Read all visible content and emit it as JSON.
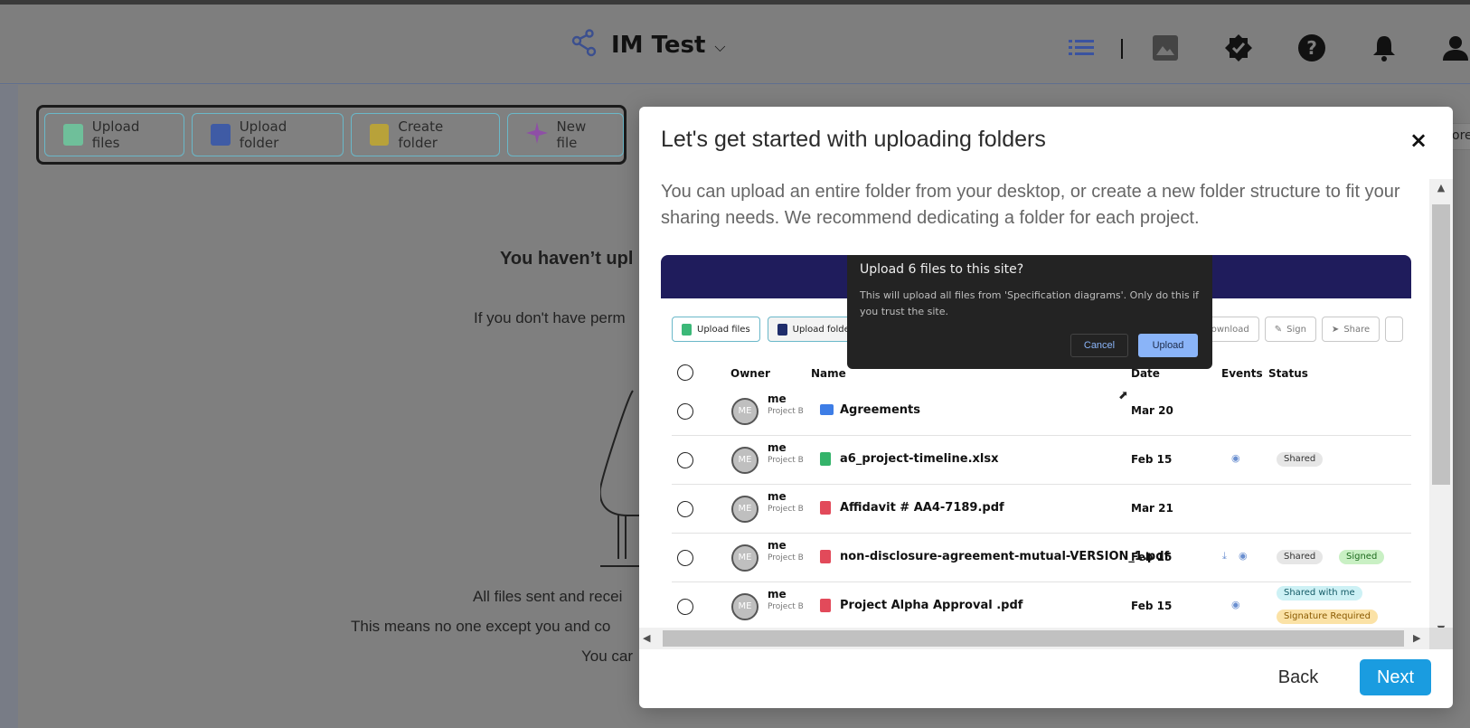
{
  "header": {
    "title": "IM Test",
    "icons": [
      "workflow-icon",
      "chevron-down-icon",
      "list-view-icon",
      "gallery-icon",
      "verified-badge-icon",
      "help-icon",
      "bell-icon",
      "user-icon"
    ]
  },
  "toolbar": {
    "upload_files": "Upload files",
    "upload_folder": "Upload folder",
    "create_folder": "Create folder",
    "new_file": "New file"
  },
  "empty": {
    "title": "You haven’t upl",
    "subtitle": "If you don't have perm",
    "line1": "All files sent and recei",
    "line2": "This means no one except you and co",
    "line3": "You car"
  },
  "right_peek": "ore",
  "modal": {
    "title": "Let's get started with uploading folders",
    "description": "You can upload an entire folder from your desktop, or create a new folder structure to fit your sharing needs. We recommend dedicating a folder for each project.",
    "back": "Back",
    "next": "Next",
    "close": "×"
  },
  "screenshot": {
    "dialog": {
      "title": "Upload 6 files to this site?",
      "body": "This will upload all files from 'Specification diagrams'. Only do this if you trust the site.",
      "cancel": "Cancel",
      "upload": "Upload"
    },
    "toolbar_left": [
      "Upload files",
      "Upload folder"
    ],
    "toolbar_right": [
      "Download",
      "Sign",
      "Share"
    ],
    "columns": {
      "owner": "Owner",
      "name": "Name",
      "date": "Date",
      "events": "Events",
      "status": "Status"
    },
    "rows": [
      {
        "avatar": "ME",
        "owner": "me",
        "project": "Project B",
        "name": "Agreements",
        "type": "folder",
        "date": "Mar 20",
        "events": [],
        "status": []
      },
      {
        "avatar": "ME",
        "owner": "me",
        "project": "Project B",
        "name": "a6_project-timeline.xlsx",
        "type": "sheet",
        "date": "Feb 15",
        "events": [
          "eye"
        ],
        "status": [
          "Shared"
        ]
      },
      {
        "avatar": "ME",
        "owner": "me",
        "project": "Project B",
        "name": "Affidavit # AA4-7189.pdf",
        "type": "pdf",
        "date": "Mar 21",
        "events": [],
        "status": []
      },
      {
        "avatar": "ME",
        "owner": "me",
        "project": "Project B",
        "name": "non-disclosure-agreement-mutual-VERSION_1.pdf",
        "type": "pdf",
        "date": "Feb 15",
        "events": [
          "download",
          "eye"
        ],
        "status": [
          "Shared",
          "Signed"
        ]
      },
      {
        "avatar": "ME",
        "owner": "me",
        "project": "Project B",
        "name": "Project Alpha Approval .pdf",
        "type": "pdf",
        "date": "Feb 15",
        "events": [
          "eye"
        ],
        "status": [
          "Shared with me",
          "Signature Required"
        ]
      }
    ]
  },
  "colors": {
    "accent": "#1a9ce0",
    "brand_dark": "#1f1c5c",
    "overlay": "#7f7f7f"
  }
}
